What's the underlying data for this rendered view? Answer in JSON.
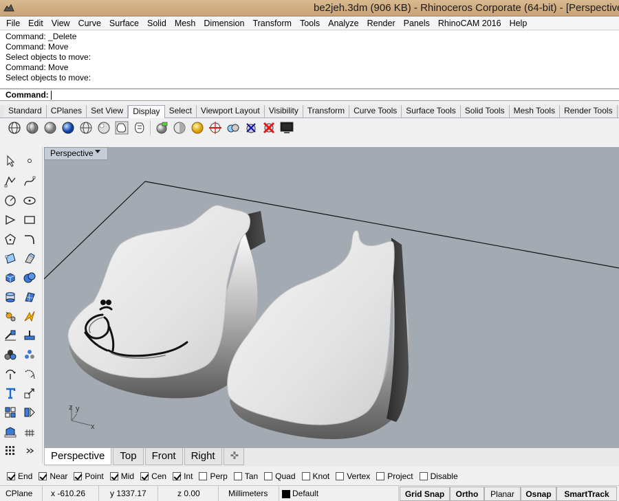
{
  "window": {
    "title": "be2jeh.3dm (906 KB) - Rhinoceros Corporate (64-bit) - [Perspective"
  },
  "menu": [
    "File",
    "Edit",
    "View",
    "Curve",
    "Surface",
    "Solid",
    "Mesh",
    "Dimension",
    "Transform",
    "Tools",
    "Analyze",
    "Render",
    "Panels",
    "RhinoCAM 2016",
    "Help"
  ],
  "command_history": [
    "Command: _Delete",
    "Command: Move",
    "Select objects to move:",
    "Command: Move",
    "Select objects to move:"
  ],
  "command_prompt": {
    "label": "Command:",
    "value": ""
  },
  "toolbar_tabs": [
    "Standard",
    "CPlanes",
    "Set View",
    "Display",
    "Select",
    "Viewport Layout",
    "Visibility",
    "Transform",
    "Curve Tools",
    "Surface Tools",
    "Solid Tools",
    "Mesh Tools",
    "Render Tools"
  ],
  "active_toolbar_tab": "Display",
  "viewport": {
    "name": "Perspective",
    "axis_labels": {
      "z": "z",
      "y": "y",
      "x": "x"
    }
  },
  "viewport_tabs": [
    "Perspective",
    "Top",
    "Front",
    "Right"
  ],
  "osnaps": [
    {
      "label": "End",
      "checked": true
    },
    {
      "label": "Near",
      "checked": true
    },
    {
      "label": "Point",
      "checked": true
    },
    {
      "label": "Mid",
      "checked": true
    },
    {
      "label": "Cen",
      "checked": true
    },
    {
      "label": "Int",
      "checked": true
    },
    {
      "label": "Perp",
      "checked": false
    },
    {
      "label": "Tan",
      "checked": false
    },
    {
      "label": "Quad",
      "checked": false
    },
    {
      "label": "Knot",
      "checked": false
    },
    {
      "label": "Vertex",
      "checked": false
    },
    {
      "label": "Project",
      "checked": false
    },
    {
      "label": "Disable",
      "checked": false
    }
  ],
  "status": {
    "cplane": "CPlane",
    "x": "x -610.26",
    "y": "y 1337.17",
    "z": "z 0.00",
    "units": "Millimeters",
    "layer": "Default",
    "panes": [
      "Grid Snap",
      "Ortho",
      "Planar",
      "Osnap",
      "SmartTrack"
    ]
  },
  "colors": {
    "viewport_bg": "#a4aab2",
    "titlebar": "#c9a478",
    "model": "#dedede"
  }
}
